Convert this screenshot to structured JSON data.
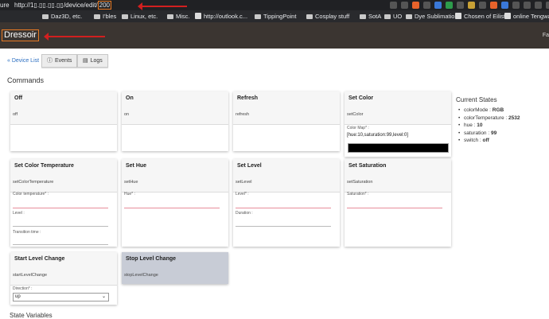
{
  "browser": {
    "url_prefix_left": "ure",
    "url": "http://1▯.▯▯.▯▯.▯▯/device/edit/",
    "url_highlight": "200",
    "bookmarks": [
      {
        "label": "Daz3D, etc.",
        "type": "folder"
      },
      {
        "label": "I'bles",
        "type": "folder"
      },
      {
        "label": "Linux, etc.",
        "type": "folder"
      },
      {
        "label": "Misc.",
        "type": "folder"
      },
      {
        "label": "http://outlook.c...",
        "type": "site"
      },
      {
        "label": "TippingPoint",
        "type": "folder"
      },
      {
        "label": "Cosplay stuff",
        "type": "folder"
      },
      {
        "label": "SotA",
        "type": "folder"
      },
      {
        "label": "UO",
        "type": "folder"
      },
      {
        "label": "Dye Sublimation",
        "type": "folder"
      },
      {
        "label": "Chosen of Eilist...",
        "type": "site"
      },
      {
        "label": "online Tengwar...",
        "type": "site"
      }
    ]
  },
  "header": {
    "title": "Dressoir",
    "right_fragment": "Fa"
  },
  "toolbar": {
    "device_list": "« Device List",
    "events": "Events",
    "logs": "Logs"
  },
  "commands_heading": "Commands",
  "commands": {
    "off": {
      "name": "Off",
      "method": "off"
    },
    "on": {
      "name": "On",
      "method": "on"
    },
    "refresh": {
      "name": "Refresh",
      "method": "refresh"
    },
    "set_color": {
      "name": "Set Color",
      "method": "setColor",
      "field_label": "Color Map* :",
      "field_value": "[hue:10,saturation:99,level:0]"
    },
    "set_color_temperature": {
      "name": "Set Color Temperature",
      "method": "setColorTemperature",
      "field1": "Color temperature* :",
      "field2": "Level :",
      "field3": "Transition time :"
    },
    "set_hue": {
      "name": "Set Hue",
      "method": "setHue",
      "field1": "Hue* :"
    },
    "set_level": {
      "name": "Set Level",
      "method": "setLevel",
      "field1": "Level* :",
      "field2": "Duration :"
    },
    "set_saturation": {
      "name": "Set Saturation",
      "method": "setSaturation",
      "field1": "Saturation* :"
    },
    "start_level_change": {
      "name": "Start Level Change",
      "method": "startLevelChange",
      "field1": "Direction* :",
      "select_value": "up"
    },
    "stop_level_change": {
      "name": "Stop Level Change",
      "method": "stopLevelChange"
    }
  },
  "current_states": {
    "title": "Current States",
    "items": [
      {
        "key": "colorMode : ",
        "value": "RGB"
      },
      {
        "key": "colorTemperature : ",
        "value": "2532"
      },
      {
        "key": "hue : ",
        "value": "10"
      },
      {
        "key": "saturation : ",
        "value": "99"
      },
      {
        "key": "switch : ",
        "value": "off"
      }
    ]
  },
  "state_variables_heading": "State Variables",
  "colors": {
    "header_bg": "#3b3531",
    "annotation_red": "#d21f1f",
    "highlight_orange": "#e87a24",
    "link_blue": "#2c6fc1",
    "hover_card": "#c8ccd6"
  }
}
